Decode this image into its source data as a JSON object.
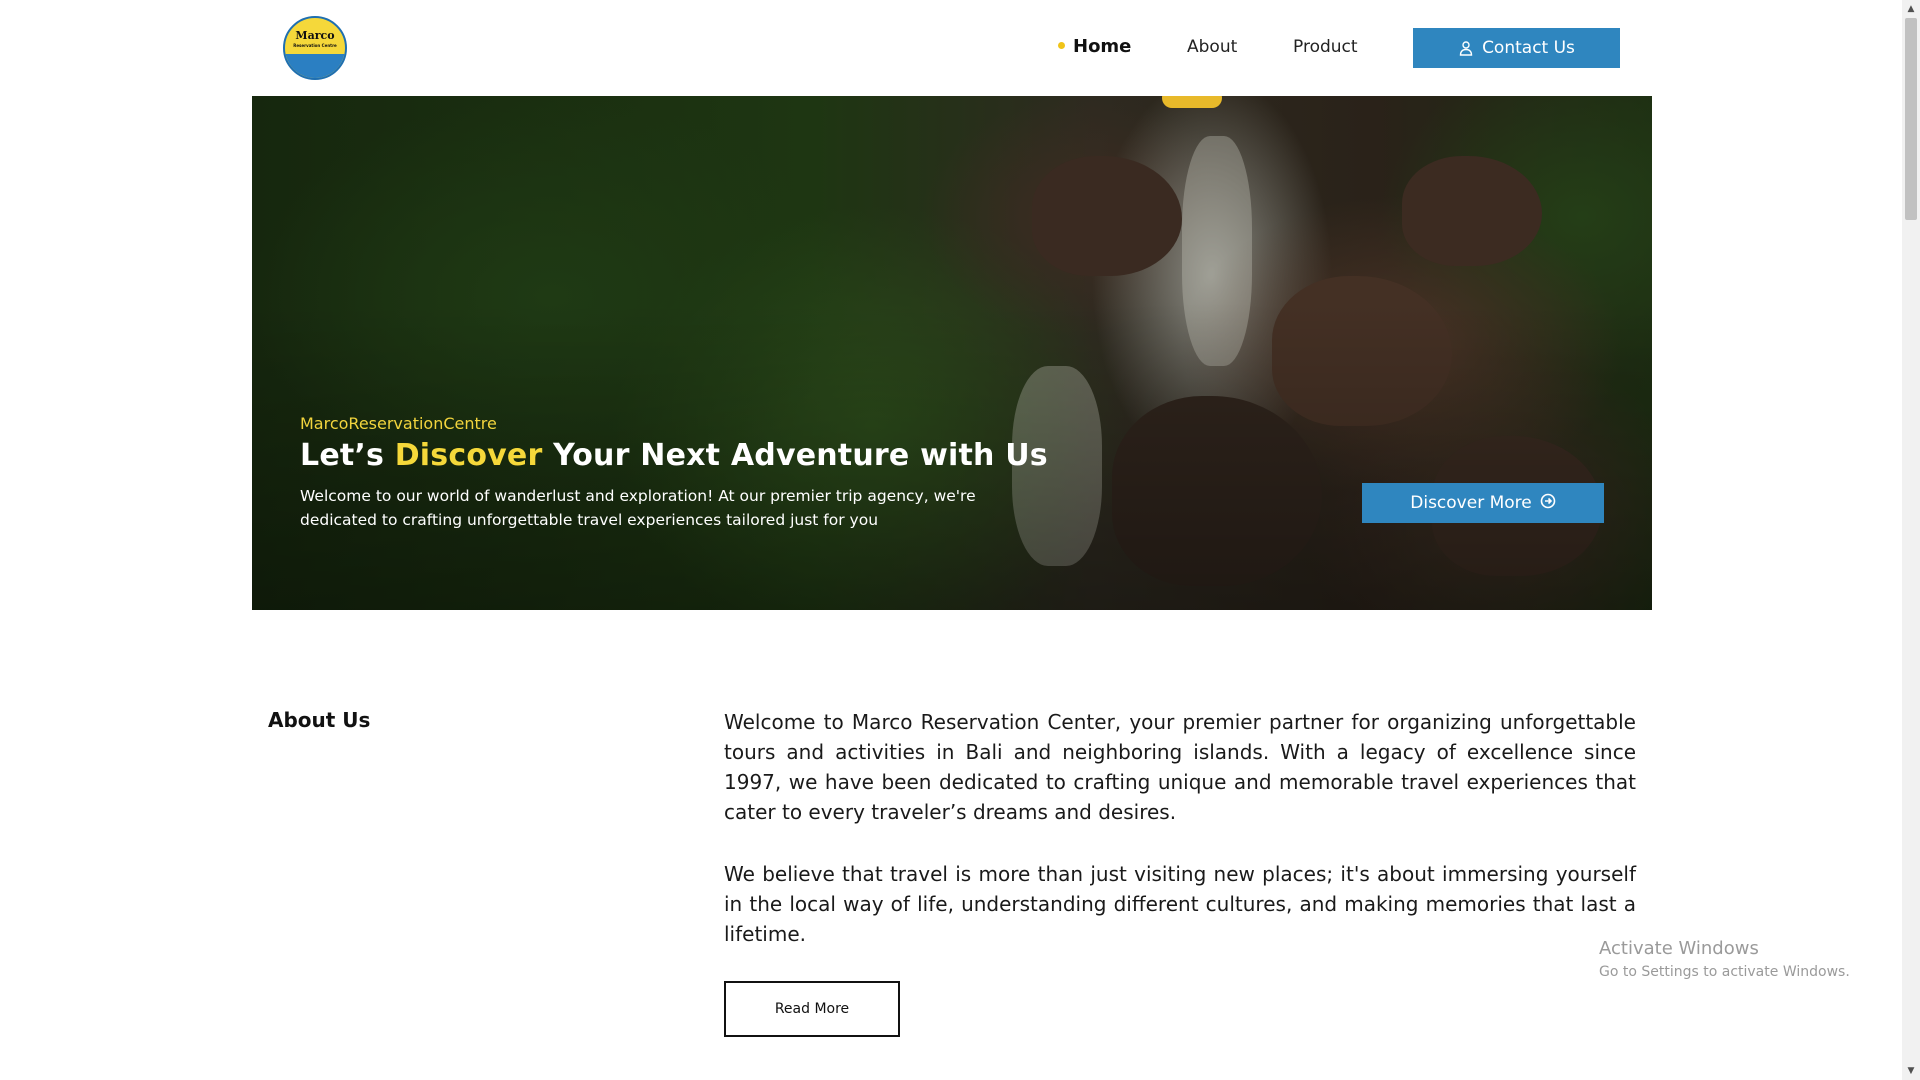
{
  "header": {
    "logo": {
      "title": "Marco",
      "subtitle": "Reservation Centre"
    },
    "nav": {
      "home": "Home",
      "about": "About",
      "product": "Product"
    },
    "contact_label": "Contact Us"
  },
  "hero": {
    "brand": "MarcoReservationCentre",
    "title_pre": "Let’s ",
    "title_accent": "Discover",
    "title_post": " Your Next Adventure with Us",
    "description": "Welcome to our world of wanderlust and exploration! At our premier trip agency, we're dedicated to crafting unforgettable travel experiences tailored just for you",
    "cta_label": "Discover More"
  },
  "about": {
    "heading": "About Us",
    "paragraph_1": "Welcome to Marco Reservation Center, your premier partner for organizing unforgettable tours and activities in Bali and neighboring islands. With a legacy of excellence since 1997, we have been dedicated to crafting unique and memorable travel experiences that cater to every traveler’s dreams and desires.",
    "paragraph_2": "We believe that travel is more than just visiting new places; it's about immersing yourself in the local way of life, understanding different cultures, and making memories that last a lifetime.",
    "read_more_label": "Read More"
  },
  "watermark": {
    "title": "Activate Windows",
    "subtitle": "Go to Settings to activate Windows."
  },
  "colors": {
    "accent_blue": "#2f86bf",
    "accent_yellow": "#f5d83a"
  },
  "icons": {
    "contact": "user-icon",
    "discover": "arrow-circle-right-icon"
  }
}
